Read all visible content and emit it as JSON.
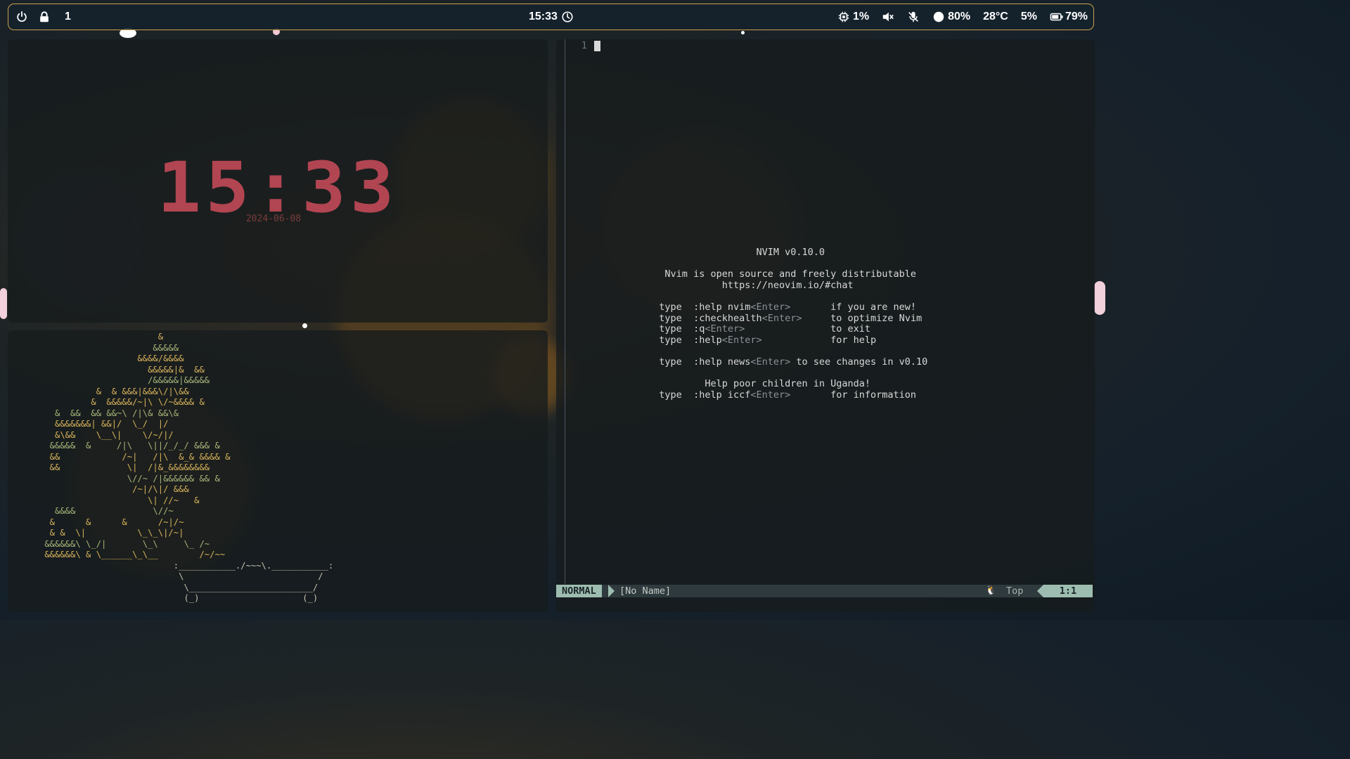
{
  "topbar": {
    "workspace": "1",
    "time": "15:33",
    "cpu": "1%",
    "brightness": "80%",
    "temperature": "28°C",
    "disk": "5%",
    "battery": "79%",
    "icons": [
      "power-icon",
      "lock-icon",
      "clock-icon",
      "cpu-icon",
      "speaker-muted-icon",
      "mic-muted-icon",
      "brightness-icon",
      "battery-icon"
    ],
    "accent": "#c9a24a"
  },
  "clock": {
    "time": "15:33",
    "date": "2024-06-08",
    "color": "#b24552"
  },
  "bonsai": {
    "lines": [
      "                       &",
      "                      &&&&&",
      "                   &&&&/&&&&",
      "                     &&&&&|&  &&",
      "                     /&&&&&|&&&&&",
      "           &  & &&&|&&&\\/|\\&&",
      "          &  &&&&&/~|\\ \\/~&&&& &",
      "   &  &&  && &&~\\ /|\\& &&\\&",
      "   &&&&&&&| &&|/  \\_/  |/",
      "   &\\&&    \\__\\|    \\/~/|/",
      "  &&&&&  &     /|\\   \\||/_/_/ &&& &",
      "  &&            /~|   /|\\  &_& &&&& &",
      "  &&             \\|  /|&_&&&&&&&&",
      "                 \\//~ /|&&&&&& && &",
      "                  /~|/\\|/ &&&",
      "                     \\| //~   &",
      "   &&&&               \\//~",
      "  &      &      &      /~|/~",
      "  & &  \\|          \\_\\_\\|/~|",
      " &&&&&&\\ \\_/|       \\_\\     \\_ /~",
      " &&&&&&\\ & \\______\\_\\__        /~/~~",
      "                          :___________./~~~\\.___________:",
      "                           \\                          /",
      "                            \\________________________/",
      "                            (_)                    (_)"
    ]
  },
  "nvim": {
    "line_number": "1",
    "intro": [
      {
        "t": "NVIM v0.10.0",
        "pad": "                                   "
      },
      {
        "t": "",
        "pad": ""
      },
      {
        "t": "Nvim is open source and freely distributable",
        "pad": "                   "
      },
      {
        "t": "https://neovim.io/#chat",
        "pad": "                             "
      },
      {
        "t": "",
        "pad": ""
      },
      {
        "t": "type  :help nvim<Enter>       if you are new!",
        "pad": "                  "
      },
      {
        "t": "type  :checkhealth<Enter>     to optimize Nvim",
        "pad": "                  "
      },
      {
        "t": "type  :q<Enter>               to exit",
        "pad": "                  "
      },
      {
        "t": "type  :help<Enter>            for help",
        "pad": "                  "
      },
      {
        "t": "",
        "pad": ""
      },
      {
        "t": "type  :help news<Enter> to see changes in v0.10",
        "pad": "                  "
      },
      {
        "t": "",
        "pad": ""
      },
      {
        "t": "Help poor children in Uganda!",
        "pad": "                          "
      },
      {
        "t": "type  :help iccf<Enter>       for information",
        "pad": "                  "
      }
    ],
    "status": {
      "mode": "NORMAL",
      "file": "[No Name]",
      "tux": "🐧",
      "position": "Top",
      "cursor": "1:1"
    },
    "accent": "#9dbdb0"
  }
}
